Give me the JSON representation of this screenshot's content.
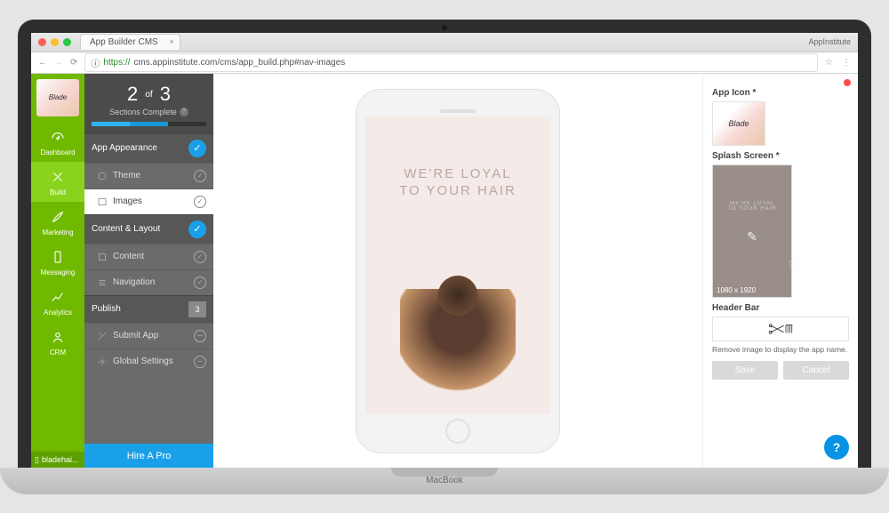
{
  "browser": {
    "tab_title": "App Builder CMS",
    "brand": "AppInstitute",
    "url_prefix": "https://",
    "url": "cms.appinstitute.com/cms/app_build.php#nav-images"
  },
  "sidebar": {
    "logo_text": "Blade",
    "items": [
      {
        "icon": "dashboard",
        "label": "Dashboard"
      },
      {
        "icon": "build",
        "label": "Build"
      },
      {
        "icon": "marketing",
        "label": "Marketing"
      },
      {
        "icon": "messaging",
        "label": "Messaging"
      },
      {
        "icon": "analytics",
        "label": "Analytics"
      },
      {
        "icon": "crm",
        "label": "CRM"
      }
    ],
    "footer": "bladehai..."
  },
  "progress": {
    "current": "2",
    "of_label": "of",
    "total": "3",
    "subtitle": "Sections Complete"
  },
  "groups": [
    {
      "title": "App Appearance",
      "status": "done",
      "items": [
        {
          "icon": "theme",
          "label": "Theme",
          "checked": true,
          "active": false
        },
        {
          "icon": "images",
          "label": "Images",
          "checked": true,
          "active": true
        }
      ]
    },
    {
      "title": "Content & Layout",
      "status": "done",
      "items": [
        {
          "icon": "content",
          "label": "Content",
          "checked": true,
          "active": false
        },
        {
          "icon": "navigation",
          "label": "Navigation",
          "checked": true,
          "active": false
        }
      ]
    },
    {
      "title": "Publish",
      "status": "num",
      "badge": "3",
      "items": [
        {
          "icon": "submit",
          "label": "Submit App",
          "checked": false,
          "active": false
        },
        {
          "icon": "settings",
          "label": "Global Settings",
          "checked": false,
          "active": false
        }
      ]
    }
  ],
  "hire_label": "Hire A Pro",
  "preview": {
    "slogan_line1": "WE'RE LOYAL",
    "slogan_line2": "TO YOUR HAIR"
  },
  "right": {
    "app_icon_label": "App Icon *",
    "app_icon_text": "Blade",
    "splash_label": "Splash Screen *",
    "splash_line1": "WE'RE LOYAL",
    "splash_line2": "TO YOUR HAIR",
    "splash_dims": "1080 x 1920",
    "header_label": "Header Bar",
    "hint": "Remove image to display the app name.",
    "save": "Save",
    "cancel": "Cancel"
  },
  "laptop_label": "MacBook"
}
